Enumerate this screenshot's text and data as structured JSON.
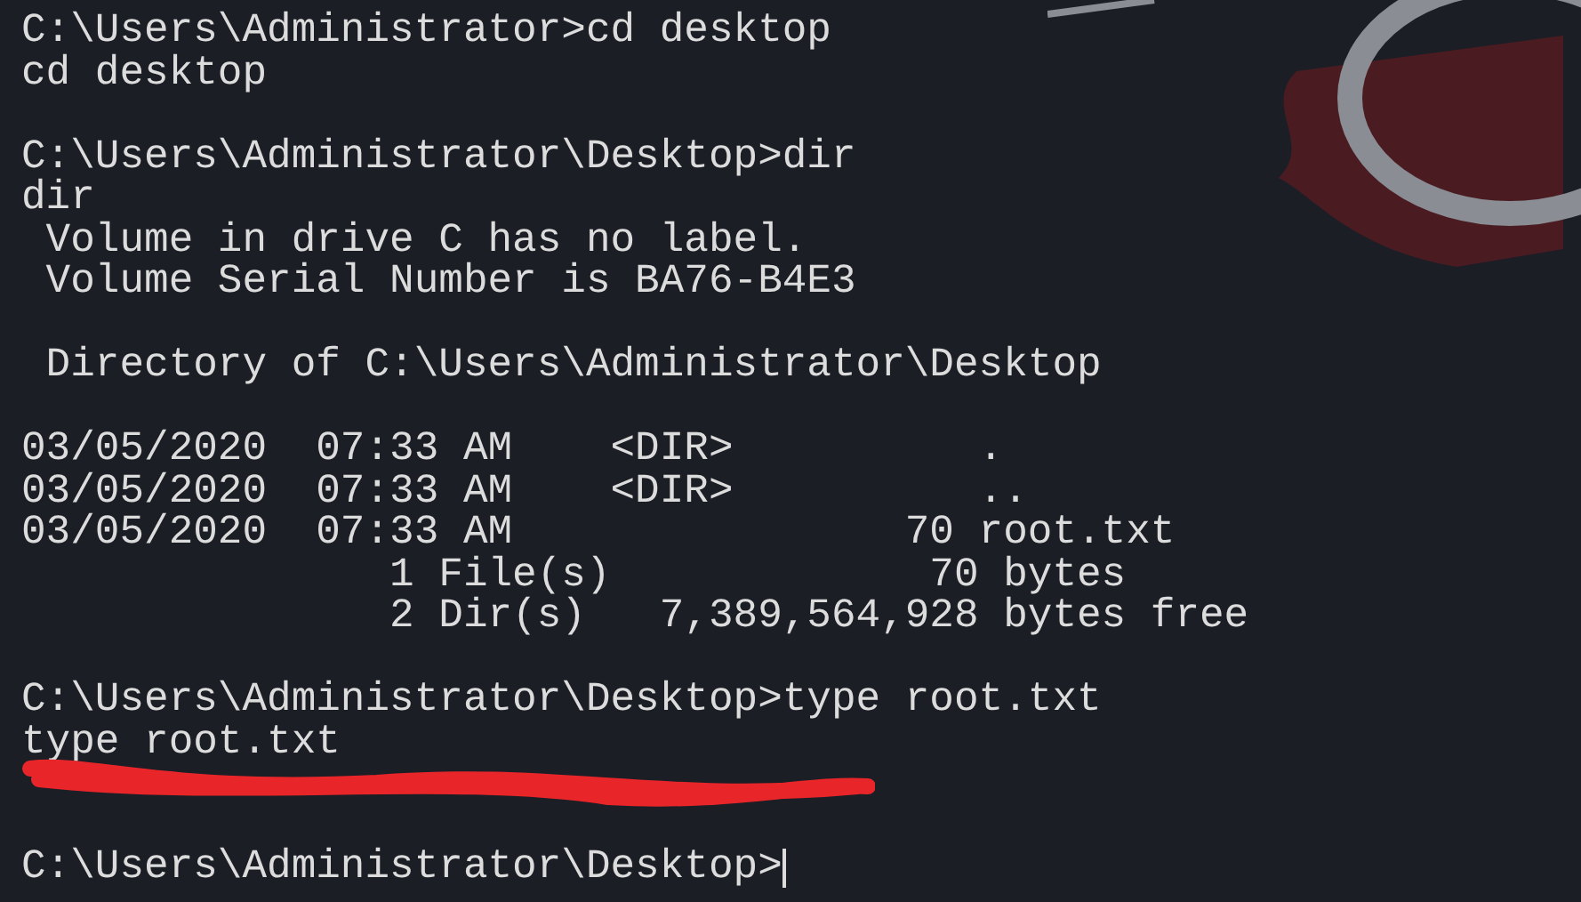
{
  "terminal": {
    "lines": [
      {
        "kind": "text",
        "text": "C:\\Users\\Administrator>cd desktop"
      },
      {
        "kind": "text",
        "text": "cd desktop"
      },
      {
        "kind": "blank"
      },
      {
        "kind": "text",
        "text": "C:\\Users\\Administrator\\Desktop>dir"
      },
      {
        "kind": "text",
        "text": "dir"
      },
      {
        "kind": "text",
        "text": " Volume in drive C has no label."
      },
      {
        "kind": "text",
        "text": " Volume Serial Number is BA76-B4E3"
      },
      {
        "kind": "blank"
      },
      {
        "kind": "text",
        "text": " Directory of C:\\Users\\Administrator\\Desktop"
      },
      {
        "kind": "blank"
      },
      {
        "kind": "text",
        "text": "03/05/2020  07:33 AM    <DIR>          ."
      },
      {
        "kind": "text",
        "text": "03/05/2020  07:33 AM    <DIR>          .."
      },
      {
        "kind": "text",
        "text": "03/05/2020  07:33 AM                70 root.txt"
      },
      {
        "kind": "text",
        "text": "               1 File(s)             70 bytes"
      },
      {
        "kind": "text",
        "text": "               2 Dir(s)   7,389,564,928 bytes free"
      },
      {
        "kind": "blank"
      },
      {
        "kind": "text",
        "text": "C:\\Users\\Administrator\\Desktop>type root.txt"
      },
      {
        "kind": "text",
        "text": "type root.txt"
      },
      {
        "kind": "redacted"
      },
      {
        "kind": "blank"
      },
      {
        "kind": "prompt",
        "text": "C:\\Users\\Administrator\\Desktop>"
      }
    ]
  }
}
